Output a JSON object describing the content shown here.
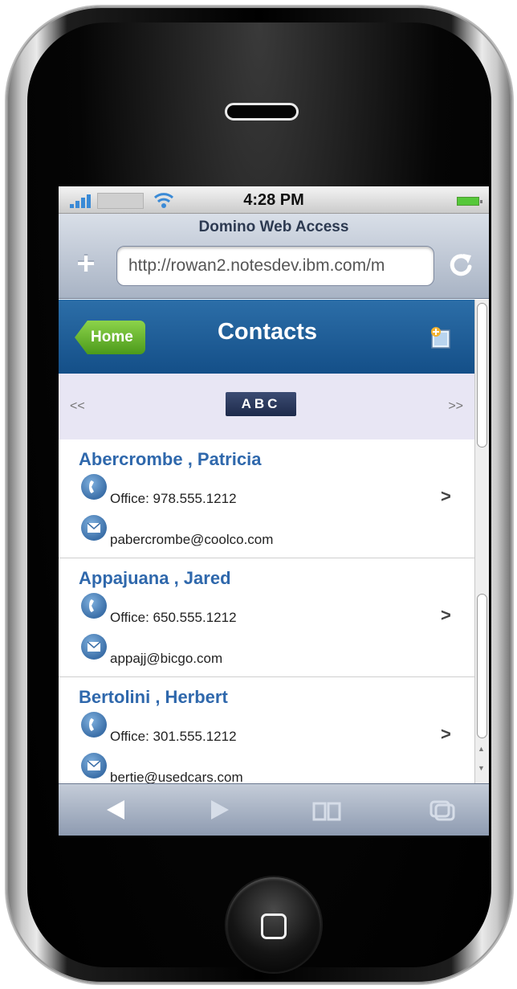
{
  "status": {
    "time": "4:28 PM"
  },
  "browser": {
    "page_title": "Domino Web Access",
    "url": "http://rowan2.notesdev.ibm.com/m"
  },
  "app": {
    "back_label": "Home",
    "title": "Contacts",
    "prev": "<<",
    "next": ">>",
    "letters": "ABC"
  },
  "contacts": [
    {
      "name": "Abercrombe , Patricia",
      "office": "Office: 978.555.1212",
      "email": "pabercrombe@coolco.com"
    },
    {
      "name": "Appajuana , Jared",
      "office": "Office: 650.555.1212",
      "email": "appajj@bicgo.com"
    },
    {
      "name": "Bertolini , Herbert",
      "office": "Office: 301.555.1212",
      "email": "bertie@usedcars.com"
    }
  ],
  "colors": {
    "header": "#1d5a93",
    "home_button": "#6ab93a",
    "name_link": "#2f68ac",
    "alpha_bar": "#e8e6f4"
  }
}
